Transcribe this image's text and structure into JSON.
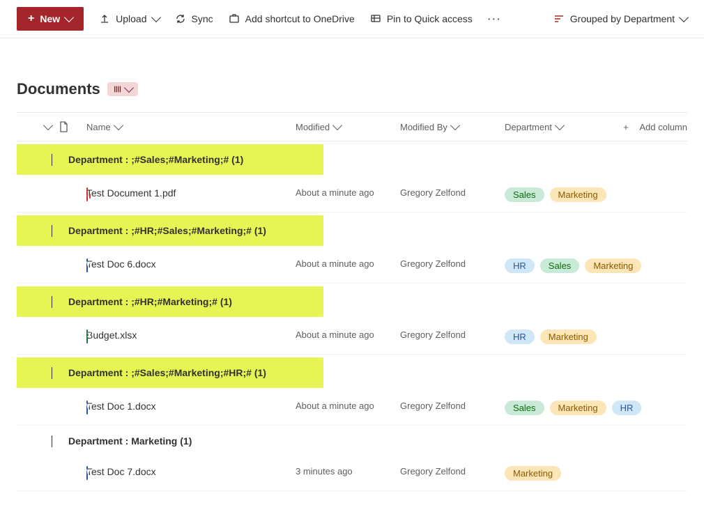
{
  "toolbar": {
    "new_label": "New",
    "upload_label": "Upload",
    "sync_label": "Sync",
    "shortcut_label": "Add shortcut to OneDrive",
    "pin_label": "Pin to Quick access",
    "grouped_label": "Grouped by Department"
  },
  "page": {
    "title": "Documents"
  },
  "columns": {
    "name": "Name",
    "modified": "Modified",
    "modified_by": "Modified By",
    "department": "Department",
    "add": "Add column"
  },
  "groups": [
    {
      "label": "Department : ;#Sales;#Marketing;# (1)",
      "highlight": true,
      "items": [
        {
          "icon": "pdf",
          "name": "Test Document 1.pdf",
          "modified": "About a minute ago",
          "modified_by": "Gregory Zelfond",
          "tags": [
            "Sales",
            "Marketing"
          ]
        }
      ]
    },
    {
      "label": "Department : ;#HR;#Sales;#Marketing;# (1)",
      "highlight": true,
      "items": [
        {
          "icon": "word",
          "name": "Test Doc 6.docx",
          "modified": "About a minute ago",
          "modified_by": "Gregory Zelfond",
          "tags": [
            "HR",
            "Sales",
            "Marketing"
          ]
        }
      ]
    },
    {
      "label": "Department : ;#HR;#Marketing;# (1)",
      "highlight": true,
      "items": [
        {
          "icon": "excel",
          "name": "Budget.xlsx",
          "modified": "About a minute ago",
          "modified_by": "Gregory Zelfond",
          "tags": [
            "HR",
            "Marketing"
          ]
        }
      ]
    },
    {
      "label": "Department : ;#Sales;#Marketing;#HR;# (1)",
      "highlight": true,
      "items": [
        {
          "icon": "word",
          "name": "Test Doc 1.docx",
          "modified": "About a minute ago",
          "modified_by": "Gregory Zelfond",
          "tags": [
            "Sales",
            "Marketing",
            "HR"
          ]
        }
      ]
    },
    {
      "label": "Department : Marketing (1)",
      "highlight": false,
      "items": [
        {
          "icon": "word",
          "name": "Test Doc 7.docx",
          "modified": "3 minutes ago",
          "modified_by": "Gregory Zelfond",
          "tags": [
            "Marketing"
          ]
        }
      ]
    }
  ],
  "tag_colors": {
    "Sales": "tag-sales",
    "Marketing": "tag-marketing",
    "HR": "tag-hr"
  }
}
